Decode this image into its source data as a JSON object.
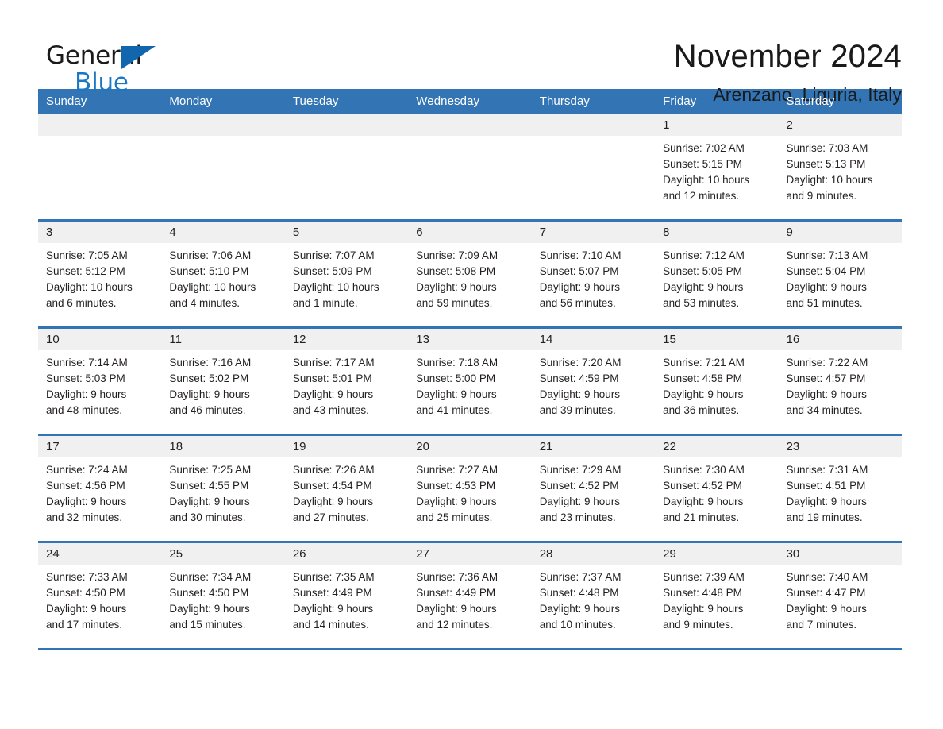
{
  "brand": {
    "name_part1": "General",
    "name_part2": "Blue",
    "triangle_color": "#1166ad",
    "blue_color": "#1878c4"
  },
  "header": {
    "month_title": "November 2024",
    "location": "Arenzano, Liguria, Italy"
  },
  "colors": {
    "header_blue": "#3274b4",
    "day_band_gray": "#f0f0f0",
    "text": "#231f20"
  },
  "calendar": {
    "day_names": [
      "Sunday",
      "Monday",
      "Tuesday",
      "Wednesday",
      "Thursday",
      "Friday",
      "Saturday"
    ],
    "weeks": [
      [
        {
          "day": "",
          "lines": []
        },
        {
          "day": "",
          "lines": []
        },
        {
          "day": "",
          "lines": []
        },
        {
          "day": "",
          "lines": []
        },
        {
          "day": "",
          "lines": []
        },
        {
          "day": "1",
          "lines": [
            "Sunrise: 7:02 AM",
            "Sunset: 5:15 PM",
            "Daylight: 10 hours",
            "and 12 minutes."
          ]
        },
        {
          "day": "2",
          "lines": [
            "Sunrise: 7:03 AM",
            "Sunset: 5:13 PM",
            "Daylight: 10 hours",
            "and 9 minutes."
          ]
        }
      ],
      [
        {
          "day": "3",
          "lines": [
            "Sunrise: 7:05 AM",
            "Sunset: 5:12 PM",
            "Daylight: 10 hours",
            "and 6 minutes."
          ]
        },
        {
          "day": "4",
          "lines": [
            "Sunrise: 7:06 AM",
            "Sunset: 5:10 PM",
            "Daylight: 10 hours",
            "and 4 minutes."
          ]
        },
        {
          "day": "5",
          "lines": [
            "Sunrise: 7:07 AM",
            "Sunset: 5:09 PM",
            "Daylight: 10 hours",
            "and 1 minute."
          ]
        },
        {
          "day": "6",
          "lines": [
            "Sunrise: 7:09 AM",
            "Sunset: 5:08 PM",
            "Daylight: 9 hours",
            "and 59 minutes."
          ]
        },
        {
          "day": "7",
          "lines": [
            "Sunrise: 7:10 AM",
            "Sunset: 5:07 PM",
            "Daylight: 9 hours",
            "and 56 minutes."
          ]
        },
        {
          "day": "8",
          "lines": [
            "Sunrise: 7:12 AM",
            "Sunset: 5:05 PM",
            "Daylight: 9 hours",
            "and 53 minutes."
          ]
        },
        {
          "day": "9",
          "lines": [
            "Sunrise: 7:13 AM",
            "Sunset: 5:04 PM",
            "Daylight: 9 hours",
            "and 51 minutes."
          ]
        }
      ],
      [
        {
          "day": "10",
          "lines": [
            "Sunrise: 7:14 AM",
            "Sunset: 5:03 PM",
            "Daylight: 9 hours",
            "and 48 minutes."
          ]
        },
        {
          "day": "11",
          "lines": [
            "Sunrise: 7:16 AM",
            "Sunset: 5:02 PM",
            "Daylight: 9 hours",
            "and 46 minutes."
          ]
        },
        {
          "day": "12",
          "lines": [
            "Sunrise: 7:17 AM",
            "Sunset: 5:01 PM",
            "Daylight: 9 hours",
            "and 43 minutes."
          ]
        },
        {
          "day": "13",
          "lines": [
            "Sunrise: 7:18 AM",
            "Sunset: 5:00 PM",
            "Daylight: 9 hours",
            "and 41 minutes."
          ]
        },
        {
          "day": "14",
          "lines": [
            "Sunrise: 7:20 AM",
            "Sunset: 4:59 PM",
            "Daylight: 9 hours",
            "and 39 minutes."
          ]
        },
        {
          "day": "15",
          "lines": [
            "Sunrise: 7:21 AM",
            "Sunset: 4:58 PM",
            "Daylight: 9 hours",
            "and 36 minutes."
          ]
        },
        {
          "day": "16",
          "lines": [
            "Sunrise: 7:22 AM",
            "Sunset: 4:57 PM",
            "Daylight: 9 hours",
            "and 34 minutes."
          ]
        }
      ],
      [
        {
          "day": "17",
          "lines": [
            "Sunrise: 7:24 AM",
            "Sunset: 4:56 PM",
            "Daylight: 9 hours",
            "and 32 minutes."
          ]
        },
        {
          "day": "18",
          "lines": [
            "Sunrise: 7:25 AM",
            "Sunset: 4:55 PM",
            "Daylight: 9 hours",
            "and 30 minutes."
          ]
        },
        {
          "day": "19",
          "lines": [
            "Sunrise: 7:26 AM",
            "Sunset: 4:54 PM",
            "Daylight: 9 hours",
            "and 27 minutes."
          ]
        },
        {
          "day": "20",
          "lines": [
            "Sunrise: 7:27 AM",
            "Sunset: 4:53 PM",
            "Daylight: 9 hours",
            "and 25 minutes."
          ]
        },
        {
          "day": "21",
          "lines": [
            "Sunrise: 7:29 AM",
            "Sunset: 4:52 PM",
            "Daylight: 9 hours",
            "and 23 minutes."
          ]
        },
        {
          "day": "22",
          "lines": [
            "Sunrise: 7:30 AM",
            "Sunset: 4:52 PM",
            "Daylight: 9 hours",
            "and 21 minutes."
          ]
        },
        {
          "day": "23",
          "lines": [
            "Sunrise: 7:31 AM",
            "Sunset: 4:51 PM",
            "Daylight: 9 hours",
            "and 19 minutes."
          ]
        }
      ],
      [
        {
          "day": "24",
          "lines": [
            "Sunrise: 7:33 AM",
            "Sunset: 4:50 PM",
            "Daylight: 9 hours",
            "and 17 minutes."
          ]
        },
        {
          "day": "25",
          "lines": [
            "Sunrise: 7:34 AM",
            "Sunset: 4:50 PM",
            "Daylight: 9 hours",
            "and 15 minutes."
          ]
        },
        {
          "day": "26",
          "lines": [
            "Sunrise: 7:35 AM",
            "Sunset: 4:49 PM",
            "Daylight: 9 hours",
            "and 14 minutes."
          ]
        },
        {
          "day": "27",
          "lines": [
            "Sunrise: 7:36 AM",
            "Sunset: 4:49 PM",
            "Daylight: 9 hours",
            "and 12 minutes."
          ]
        },
        {
          "day": "28",
          "lines": [
            "Sunrise: 7:37 AM",
            "Sunset: 4:48 PM",
            "Daylight: 9 hours",
            "and 10 minutes."
          ]
        },
        {
          "day": "29",
          "lines": [
            "Sunrise: 7:39 AM",
            "Sunset: 4:48 PM",
            "Daylight: 9 hours",
            "and 9 minutes."
          ]
        },
        {
          "day": "30",
          "lines": [
            "Sunrise: 7:40 AM",
            "Sunset: 4:47 PM",
            "Daylight: 9 hours",
            "and 7 minutes."
          ]
        }
      ]
    ]
  }
}
